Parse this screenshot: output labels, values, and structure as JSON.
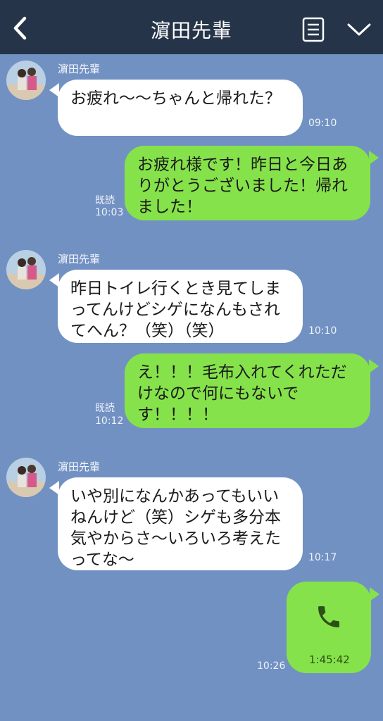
{
  "header": {
    "title": "濵田先輩",
    "back_icon": "chevron-left-icon",
    "menu_icon": "notes-icon",
    "dropdown_icon": "chevron-down-icon",
    "background": "#263449"
  },
  "chat": {
    "background": "#7291c3",
    "incoming_bubble_color": "#ffffff",
    "outgoing_bubble_color": "#86e24a",
    "messages": [
      {
        "direction": "in",
        "sender": "濵田先輩",
        "text": "お疲れ〜〜ちゃんと帰れた？",
        "time": "09:10"
      },
      {
        "direction": "out",
        "read_label": "既読",
        "text": "お疲れ様です！昨日と今日ありがとうございました！帰れました！",
        "time": "10:03"
      },
      {
        "direction": "in",
        "sender": "濵田先輩",
        "text": "昨日トイレ行くとき見てしまってんけどシゲになんもされてへん？（笑）（笑）",
        "time": "10:10"
      },
      {
        "direction": "out",
        "read_label": "既読",
        "text": "え！！！毛布入れてくれただけなので何にもないです！！！！",
        "time": "10:12"
      },
      {
        "direction": "in",
        "sender": "濵田先輩",
        "text": "いや別になんかあってもいいねんけど（笑）シゲも多分本気やからさ〜いろいろ考えたってな〜",
        "time": "10:17"
      },
      {
        "direction": "out",
        "type": "call",
        "icon": "phone-icon",
        "duration": "1:45:42",
        "time": "10:26"
      }
    ]
  }
}
